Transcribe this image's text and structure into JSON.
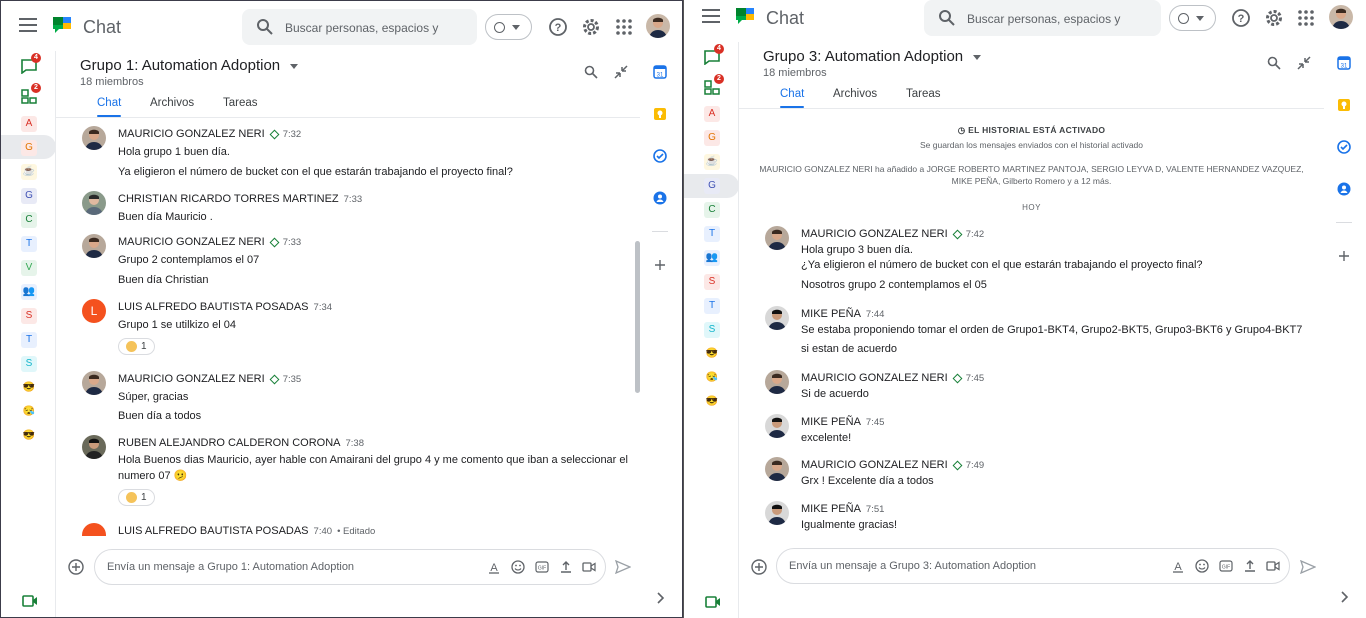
{
  "app": {
    "title": "Chat"
  },
  "search": {
    "placeholder": "Buscar personas, espacios y"
  },
  "rail": {
    "chat_badge": "4",
    "spaces_badge": "2",
    "letters_left": [
      "A",
      "G",
      "",
      "G",
      "C",
      "T",
      "V",
      "",
      "S",
      "T",
      "S"
    ],
    "letters_right": [
      "A",
      "G",
      "",
      "G",
      "C",
      "T",
      "",
      "S",
      "T",
      "S"
    ]
  },
  "left": {
    "room_title": "Grupo 1: Automation Adoption",
    "members": "18 miembros",
    "tabs": [
      "Chat",
      "Archivos",
      "Tareas"
    ],
    "messages": [
      {
        "author": "MAURICIO GONZALEZ NERI",
        "time": "7:32",
        "lines": [
          "Hola grupo 1 buen día.",
          "Ya eligieron el número de bucket con el que estarán trabajando el proyecto final?"
        ]
      },
      {
        "author": "CHRISTIAN RICARDO TORRES MARTINEZ",
        "time": "7:33",
        "lines": [
          "Buen día Mauricio ."
        ]
      },
      {
        "author": "MAURICIO GONZALEZ NERI",
        "time": "7:33",
        "lines": [
          "Grupo 2 contemplamos el 07",
          "Buen día Christian"
        ]
      },
      {
        "author": "LUIS ALFREDO BAUTISTA POSADAS",
        "time": "7:34",
        "lines": [
          "Grupo 1 se utilkizo el 04"
        ],
        "reaction": "1"
      },
      {
        "author": "MAURICIO GONZALEZ NERI",
        "time": "7:35",
        "lines": [
          "Súper, gracias",
          "Buen día a todos"
        ]
      },
      {
        "author": "RUBEN ALEJANDRO CALDERON CORONA",
        "time": "7:38",
        "lines": [
          "Hola Buenos dias Mauricio, ayer hable con Amairani del grupo 4 y me comento que iban a seleccionar el",
          "numero 07"
        ],
        "reaction": "1"
      },
      {
        "author": "LUIS ALFREDO BAUTISTA POSADAS",
        "time": "7:40",
        "edited": "• Editado"
      }
    ],
    "composer_placeholder": "Envía un mensaje a Grupo 1: Automation Adoption"
  },
  "right": {
    "room_title": "Grupo 3: Automation Adoption",
    "members": "18 miembros",
    "tabs": [
      "Chat",
      "Archivos",
      "Tareas"
    ],
    "history_title": "EL HISTORIAL ESTÁ ACTIVADO",
    "history_sub": "Se guardan los mensajes enviados con el historial activado",
    "added_line1": "MAURICIO GONZALEZ NERI ha añadido a JORGE ROBERTO MARTINEZ PANTOJA, SERGIO LEYVA D, VALENTE HERNANDEZ VAZQUEZ,",
    "added_line2": "MIKE PEÑA, Gilberto Romero y a 12 más.",
    "today": "HOY",
    "messages": [
      {
        "author": "MAURICIO GONZALEZ NERI",
        "time": "7:42",
        "lines": [
          "Hola grupo 3 buen día.",
          "¿Ya eligieron el número de bucket con el que estarán trabajando el proyecto final?",
          "Nosotros grupo 2 contemplamos el 05"
        ]
      },
      {
        "author": "MIKE PEÑA",
        "time": "7:44",
        "lines": [
          "Se estaba proponiendo tomar el orden de Grupo1-BKT4, Grupo2-BKT5, Grupo3-BKT6 y Grupo4-BKT7",
          "si estan de acuerdo"
        ]
      },
      {
        "author": "MAURICIO GONZALEZ NERI",
        "time": "7:45",
        "lines": [
          "Si de acuerdo"
        ]
      },
      {
        "author": "MIKE PEÑA",
        "time": "7:45",
        "lines": [
          "excelente!"
        ]
      },
      {
        "author": "MAURICIO GONZALEZ NERI",
        "time": "7:49",
        "lines": [
          "Grx ! Excelente día a todos"
        ]
      },
      {
        "author": "MIKE PEÑA",
        "time": "7:51",
        "lines": [
          "Igualmente gracias!"
        ]
      }
    ],
    "composer_placeholder": "Envía un mensaje a Grupo 3: Automation Adoption"
  },
  "colors": {
    "accent": "#1a73e8",
    "badge": "#d93025",
    "verified": "#188038"
  }
}
